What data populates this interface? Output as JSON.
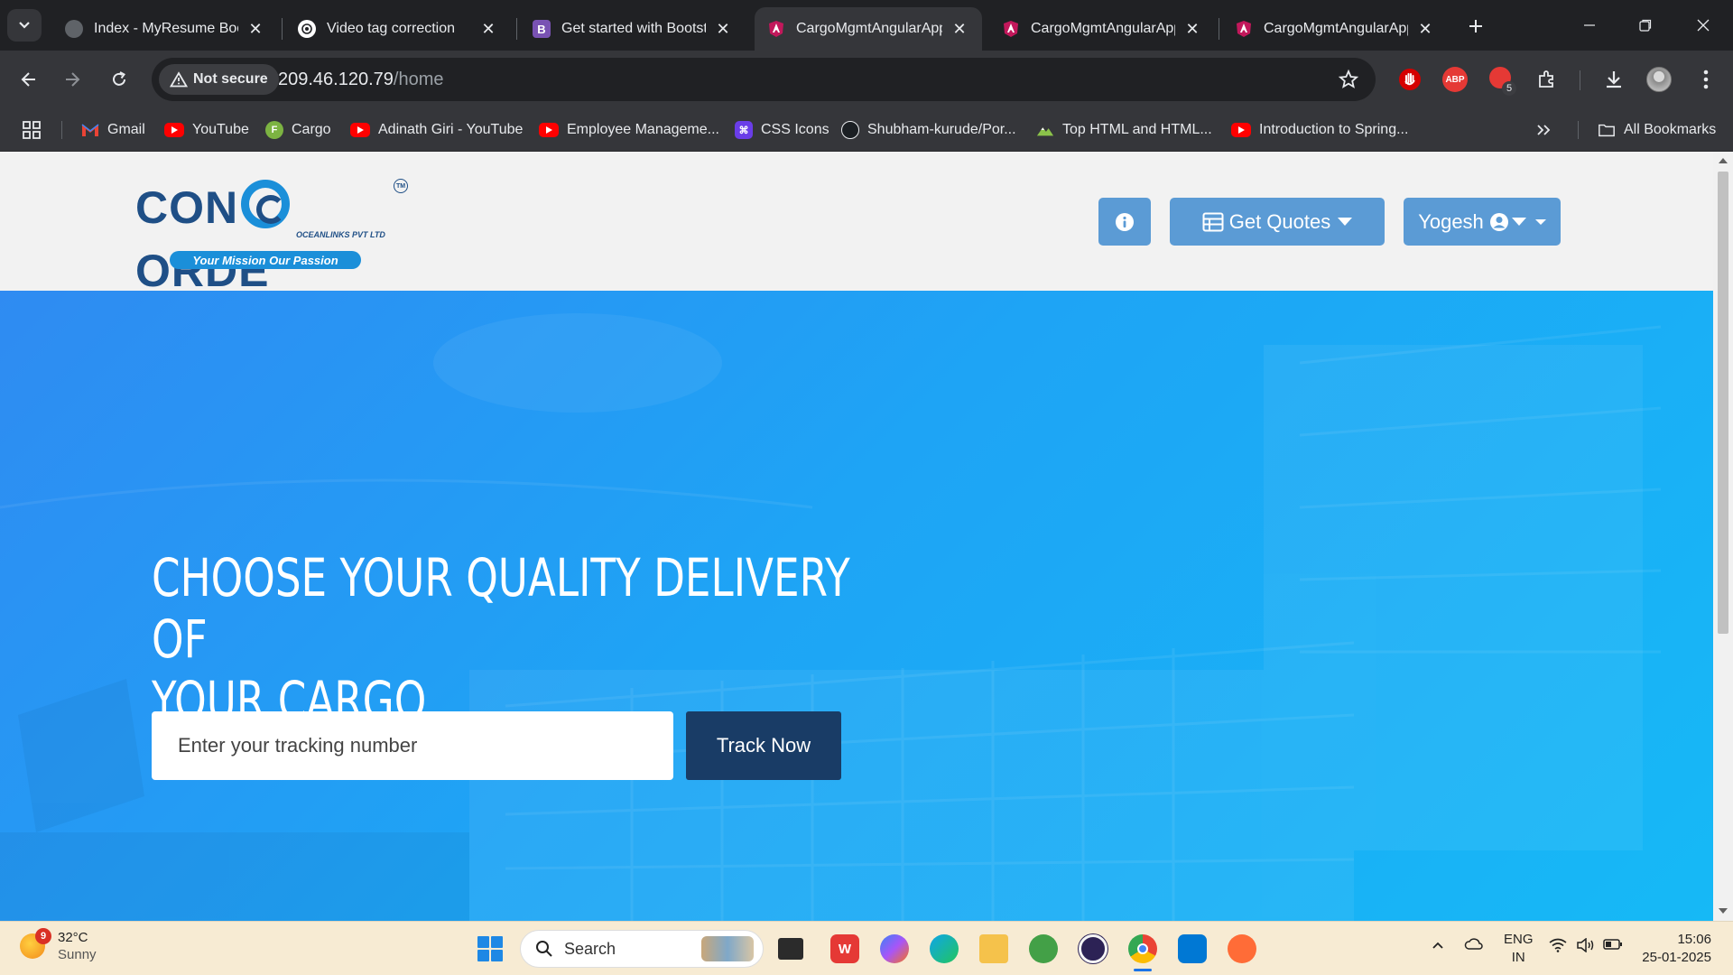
{
  "browser": {
    "tabs": [
      {
        "title": "Index - MyResume Boot",
        "favicon": "globe-icon",
        "active": false
      },
      {
        "title": "Video tag correction",
        "favicon": "openai-icon",
        "active": false
      },
      {
        "title": "Get started with Bootst",
        "favicon": "bootstrap-icon",
        "active": false
      },
      {
        "title": "CargoMgmtAngularApp",
        "favicon": "angular-icon",
        "active": true
      },
      {
        "title": "CargoMgmtAngularApp",
        "favicon": "angular-icon",
        "active": false
      },
      {
        "title": "CargoMgmtAngularApp",
        "favicon": "angular-icon",
        "active": false
      }
    ],
    "security_label": "Not secure",
    "url_host": "209.46.120.79",
    "url_path": "/home",
    "abp_label": "ABP",
    "ext_badge": "5",
    "bookmarks": [
      {
        "label": "Gmail",
        "icon": "gmail-icon"
      },
      {
        "label": "YouTube",
        "icon": "youtube-icon"
      },
      {
        "label": "Cargo",
        "icon": "cargo-icon",
        "glyph": "F"
      },
      {
        "label": "Adinath Giri - YouTube",
        "icon": "youtube-icon"
      },
      {
        "label": "Employee Manageme...",
        "icon": "youtube-icon"
      },
      {
        "label": "CSS Icons",
        "icon": "css-icons-icon",
        "glyph": "⌘"
      },
      {
        "label": "Shubham-kurude/Por...",
        "icon": "github-icon"
      },
      {
        "label": "Top HTML and HTML...",
        "icon": "mountain-icon"
      },
      {
        "label": "Introduction to Spring...",
        "icon": "youtube-icon"
      }
    ],
    "all_bookmarks_label": "All Bookmarks"
  },
  "site": {
    "logo": {
      "wordmark_left": "CON",
      "wordmark_right": "ORDE",
      "subtitle": "OCEANLINKS PVT LTD",
      "trademark": "TM",
      "tagline": "Your Mission Our Passion"
    },
    "header_buttons": {
      "quotes_label": "Get Quotes",
      "user_label": "Yogesh"
    },
    "hero": {
      "title_line1": "CHOOSE YOUR QUALITY DELIVERY OF",
      "title_line2": "YOUR CARGO",
      "tracking_placeholder": "Enter your tracking number",
      "track_button": "Track Now"
    },
    "colors": {
      "brand_blue": "#1f4f86",
      "accent_blue": "#1b8fd9",
      "header_button": "#5b9bd5",
      "track_button": "#193c66"
    }
  },
  "taskbar": {
    "weather_temp": "32°C",
    "weather_cond": "Sunny",
    "weather_badge": "9",
    "search_label": "Search",
    "lang_line1": "ENG",
    "lang_line2": "IN",
    "time": "15:06",
    "date": "25-01-2025"
  }
}
